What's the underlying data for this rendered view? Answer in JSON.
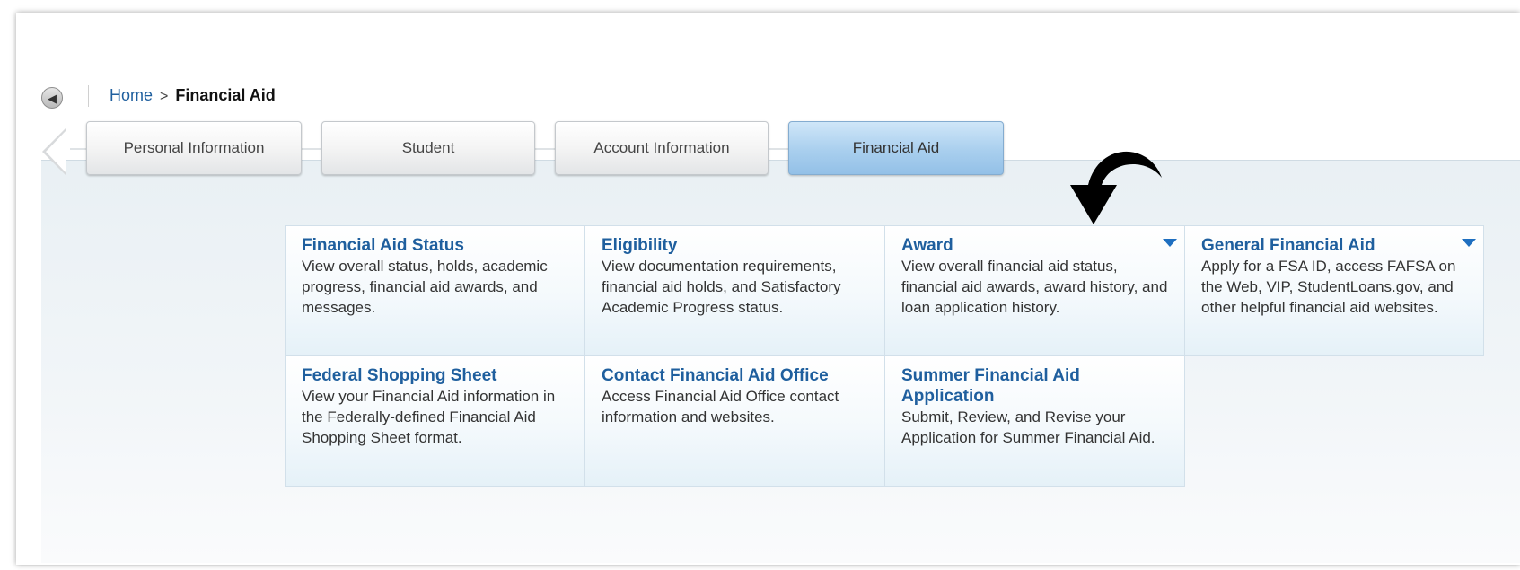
{
  "breadcrumb": {
    "home": "Home",
    "separator": ">",
    "current": "Financial Aid"
  },
  "icons": {
    "back": "back-arrow-icon",
    "tabs_prev": "chevron-left-icon",
    "dropdown": "caret-down-icon",
    "annotation": "curved-arrow-icon"
  },
  "tabs": [
    {
      "label": "Personal Information",
      "active": false
    },
    {
      "label": "Student",
      "active": false
    },
    {
      "label": "Account Information",
      "active": false
    },
    {
      "label": "Financial Aid",
      "active": true
    }
  ],
  "cards": [
    {
      "title": "Financial Aid Status",
      "desc": "View overall status, holds, academic progress, financial aid awards, and messages.",
      "dropdown": false
    },
    {
      "title": "Eligibility",
      "desc": "View documentation requirements, financial aid holds, and Satisfactory Academic Progress status.",
      "dropdown": false
    },
    {
      "title": "Award",
      "desc": "View overall financial aid status, financial aid awards, award history, and loan application history.",
      "dropdown": true
    },
    {
      "title": "General Financial Aid",
      "desc": "Apply for a FSA ID, access FAFSA on the Web, VIP, StudentLoans.gov, and other helpful financial aid websites.",
      "dropdown": true
    },
    {
      "title": "Federal Shopping Sheet",
      "desc": "View your Financial Aid information in the Federally-defined Financial Aid Shopping Sheet format.",
      "dropdown": false
    },
    {
      "title": "Contact Financial Aid Office",
      "desc": "Access Financial Aid Office contact information and websites.",
      "dropdown": false
    },
    {
      "title": "Summer Financial Aid Application",
      "desc": "Submit, Review, and Revise your Application for Summer Financial Aid.",
      "dropdown": false
    }
  ],
  "colors": {
    "link": "#1f5f9e",
    "active_tab": "#a9cfee",
    "dropdown_caret": "#1f6fc0",
    "content_bg": "#e9f0f4"
  }
}
